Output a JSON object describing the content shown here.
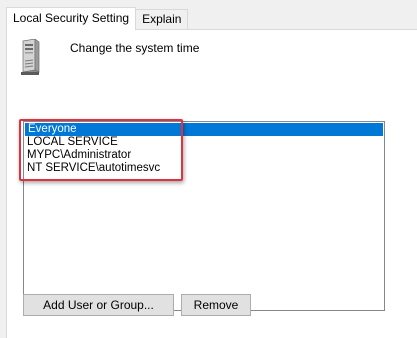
{
  "tabs": [
    {
      "label": "Local Security Setting",
      "active": true
    },
    {
      "label": "Explain",
      "active": false
    }
  ],
  "policy": {
    "icon": "computer-tower-icon",
    "title": "Change the system time"
  },
  "users": {
    "items": [
      {
        "label": "Everyone",
        "selected": true
      },
      {
        "label": "LOCAL SERVICE",
        "selected": false
      },
      {
        "label": "MYPC\\Administrator",
        "selected": false
      },
      {
        "label": "NT SERVICE\\autotimesvc",
        "selected": false
      }
    ]
  },
  "buttons": {
    "add_label": "Add User or Group...",
    "remove_label": "Remove"
  },
  "colors": {
    "selection": "#0078d7",
    "highlight": "#e0323d",
    "background": "#f0f0f0"
  }
}
